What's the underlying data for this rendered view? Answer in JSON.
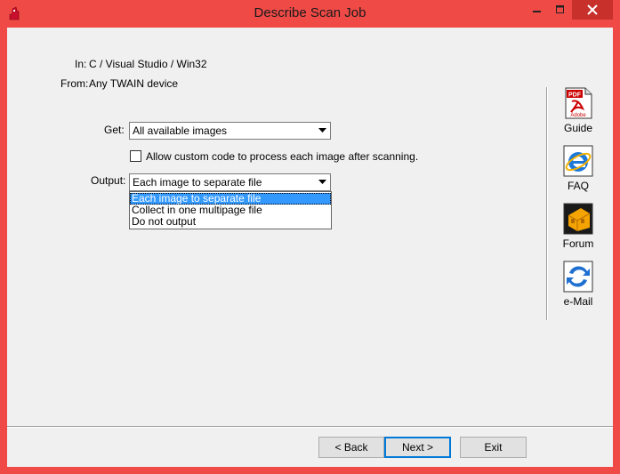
{
  "window": {
    "title": "Describe Scan Job"
  },
  "info": {
    "in_label": "In:",
    "in_value": "C / Visual Studio / Win32",
    "from_label": "From:",
    "from_value": "Any TWAIN device"
  },
  "get": {
    "label": "Get:",
    "value": "All available images"
  },
  "custom_code": {
    "label": "Allow custom code to process each image after scanning.",
    "checked": false
  },
  "output": {
    "label": "Output:",
    "value": "Each image to separate file",
    "options": [
      "Each image to separate file",
      "Collect in one multipage file",
      "Do not output"
    ],
    "selected_index": 0
  },
  "sidebar": {
    "items": [
      {
        "label": "Guide",
        "icon": "pdf-icon"
      },
      {
        "label": "FAQ",
        "icon": "ie-icon"
      },
      {
        "label": "Forum",
        "icon": "forum-icon"
      },
      {
        "label": "e-Mail",
        "icon": "email-icon"
      }
    ],
    "pdf_text": "PDF",
    "adobe_text": "Adobe"
  },
  "buttons": {
    "back": "< Back",
    "next": "Next >",
    "exit": "Exit"
  },
  "colors": {
    "titlebar": "#ef4a46",
    "close_button": "#c7302b",
    "selection": "#3399ff"
  }
}
